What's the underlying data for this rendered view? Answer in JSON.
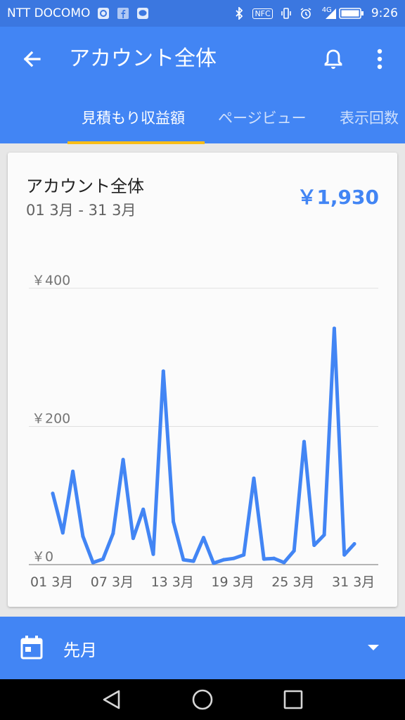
{
  "status_bar": {
    "carrier": "NTT DOCOMO",
    "time": "9:26",
    "network": "4G",
    "nfc": "NFC"
  },
  "app_bar": {
    "title": "アカウント全体",
    "tabs": [
      {
        "label": "見積もり収益額",
        "active": true
      },
      {
        "label": "ページビュー",
        "active": false
      },
      {
        "label": "表示回数",
        "active": false
      }
    ]
  },
  "card": {
    "title": "アカウント全体",
    "date_range": "01 3月 - 31 3月",
    "total": "￥1,930"
  },
  "chart_data": {
    "type": "line",
    "x": [
      "01 3月",
      "02 3月",
      "03 3月",
      "04 3月",
      "05 3月",
      "06 3月",
      "07 3月",
      "08 3月",
      "09 3月",
      "10 3月",
      "11 3月",
      "12 3月",
      "13 3月",
      "14 3月",
      "15 3月",
      "16 3月",
      "17 3月",
      "18 3月",
      "19 3月",
      "20 3月",
      "21 3月",
      "22 3月",
      "23 3月",
      "24 3月",
      "25 3月",
      "26 3月",
      "27 3月",
      "28 3月",
      "29 3月",
      "30 3月",
      "31 3月"
    ],
    "values": [
      103,
      46,
      135,
      41,
      3,
      8,
      45,
      152,
      38,
      80,
      15,
      280,
      62,
      7,
      5,
      39,
      2,
      7,
      9,
      14,
      125,
      8,
      9,
      3,
      20,
      178,
      28,
      43,
      342,
      14,
      30
    ],
    "tick_labels": [
      "01 3月",
      "07 3月",
      "13 3月",
      "19 3月",
      "25 3月",
      "31 3月"
    ],
    "tick_indices": [
      0,
      6,
      12,
      18,
      24,
      30
    ],
    "y_ticks": [
      {
        "value": 0,
        "label": "￥0"
      },
      {
        "value": 200,
        "label": "￥200"
      },
      {
        "value": 400,
        "label": "￥400"
      }
    ],
    "ylim": [
      0,
      400
    ],
    "grid": true,
    "line_color": "#4285f4"
  },
  "bottom_bar": {
    "period": "先月"
  },
  "colors": {
    "primary": "#4285f4",
    "status_bar": "#3b77e0",
    "tab_indicator": "#f9bd16"
  }
}
